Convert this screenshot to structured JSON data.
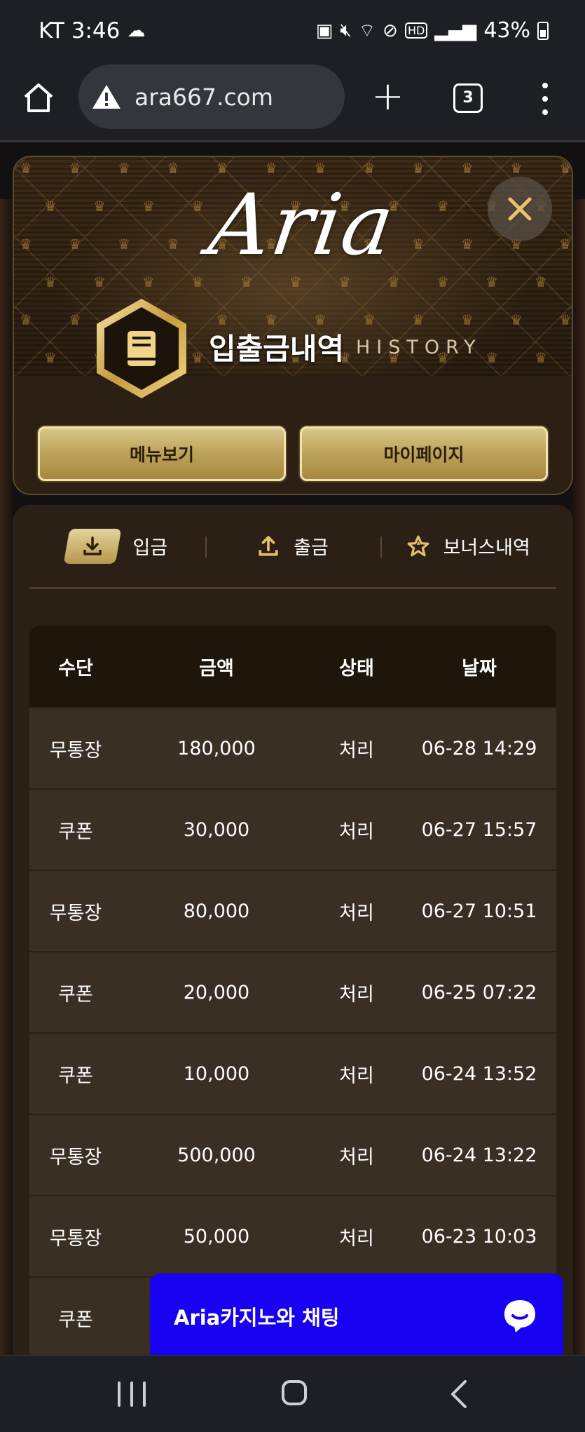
{
  "status_bar": {
    "carrier_time": "KT 3:46",
    "battery": "43%",
    "icons": [
      "cloud-icon",
      "battery-saver-icon",
      "mute-icon",
      "wifi-icon",
      "do-not-disturb-icon",
      "hd-icon",
      "signal-icon",
      "battery-icon"
    ]
  },
  "browser": {
    "url": "ara667.com",
    "tab_count": "3"
  },
  "header": {
    "logo": "Aria",
    "title_ko": "입출금내역",
    "title_en": "HISTORY",
    "buttons": {
      "menu": "메뉴보기",
      "mypage": "마이페이지"
    }
  },
  "tabs": [
    {
      "label": "입금",
      "icon": "download-icon",
      "active": true
    },
    {
      "label": "출금",
      "icon": "upload-icon",
      "active": false
    },
    {
      "label": "보너스내역",
      "icon": "star-icon",
      "active": false
    }
  ],
  "table": {
    "columns": [
      "수단",
      "금액",
      "상태",
      "날짜"
    ],
    "rows": [
      {
        "method": "무통장",
        "amount": "180,000",
        "status": "처리",
        "date": "06-28 14:29"
      },
      {
        "method": "쿠폰",
        "amount": "30,000",
        "status": "처리",
        "date": "06-27 15:57"
      },
      {
        "method": "무통장",
        "amount": "80,000",
        "status": "처리",
        "date": "06-27 10:51"
      },
      {
        "method": "쿠폰",
        "amount": "20,000",
        "status": "처리",
        "date": "06-25 07:22"
      },
      {
        "method": "쿠폰",
        "amount": "10,000",
        "status": "처리",
        "date": "06-24 13:52"
      },
      {
        "method": "무통장",
        "amount": "500,000",
        "status": "처리",
        "date": "06-24 13:22"
      },
      {
        "method": "무통장",
        "amount": "50,000",
        "status": "처리",
        "date": "06-23 10:03"
      },
      {
        "method": "쿠폰",
        "amount": "",
        "status": "",
        "date": ""
      }
    ]
  },
  "chat": {
    "label": "Aria카지노와 채팅"
  },
  "colors": {
    "gold": "#c9b070",
    "panel": "#2b2016",
    "row": "#3a2f23",
    "chat_blue": "#1800f0"
  }
}
